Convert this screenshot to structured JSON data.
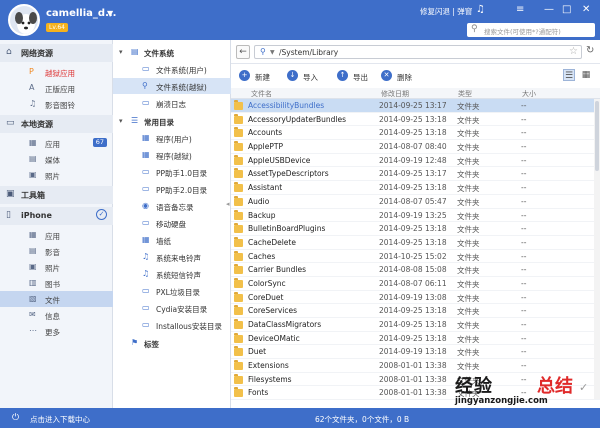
{
  "app": {
    "username": "camellia_d...",
    "vip_badge": "Lv.64",
    "repair_label": "修复闪退 | 弹窗",
    "search_placeholder": "搜索文件(可使用*?通配符)"
  },
  "sidebar": {
    "network": {
      "label": "网络资源",
      "items": [
        {
          "label": "越狱应用",
          "icon": "P",
          "red": true
        },
        {
          "label": "正版应用",
          "icon": "A"
        },
        {
          "label": "影音图铃",
          "icon": "♫"
        }
      ]
    },
    "local": {
      "label": "本地资源",
      "items": [
        {
          "label": "应用",
          "icon": "▦",
          "count": "67"
        },
        {
          "label": "媒体",
          "icon": "▤"
        },
        {
          "label": "照片",
          "icon": "▣"
        }
      ]
    },
    "toolbox": {
      "label": "工具箱"
    },
    "iphone": {
      "label": "iPhone",
      "items": [
        {
          "label": "应用",
          "icon": "▦"
        },
        {
          "label": "影音",
          "icon": "▤"
        },
        {
          "label": "照片",
          "icon": "▣"
        },
        {
          "label": "图书",
          "icon": "▥"
        },
        {
          "label": "文件",
          "icon": "▧"
        },
        {
          "label": "信息",
          "icon": "✉"
        },
        {
          "label": "更多",
          "icon": "⋯"
        }
      ]
    }
  },
  "tree": {
    "filesystem": {
      "label": "文件系统",
      "items": [
        {
          "label": "文件系统(用户)",
          "icon": "▭"
        },
        {
          "label": "文件系统(越狱)",
          "icon": "⚲"
        },
        {
          "label": "崩溃日志",
          "icon": "▭"
        }
      ]
    },
    "common": {
      "label": "常用目录",
      "items": [
        {
          "label": "程序(用户)",
          "icon": "▦"
        },
        {
          "label": "程序(越狱)",
          "icon": "▦"
        },
        {
          "label": "PP助手1.0目录",
          "icon": "▭"
        },
        {
          "label": "PP助手2.0目录",
          "icon": "▭"
        },
        {
          "label": "语音备忘录",
          "icon": "◉"
        },
        {
          "label": "移动硬盘",
          "icon": "▭"
        },
        {
          "label": "墙纸",
          "icon": "▦"
        },
        {
          "label": "系统来电铃声",
          "icon": "♫"
        },
        {
          "label": "系统短信铃声",
          "icon": "♫"
        },
        {
          "label": "PXL垃圾目录",
          "icon": "▭"
        },
        {
          "label": "Cydia安装目录",
          "icon": "▭"
        },
        {
          "label": "Installous安装目录",
          "icon": "▭"
        }
      ]
    },
    "tags": {
      "label": "标签"
    }
  },
  "path": "/System/Library",
  "toolbar": {
    "new": "新建",
    "import": "导入",
    "export": "导出",
    "delete": "删除"
  },
  "columns": {
    "name": "文件名",
    "date": "修改日期",
    "type": "类型",
    "size": "大小"
  },
  "files": [
    {
      "name": "AccessibilityBundles",
      "date": "2014-09-25 13:17",
      "type": "文件夹",
      "size": "--"
    },
    {
      "name": "AccessoryUpdaterBundles",
      "date": "2014-09-25 13:18",
      "type": "文件夹",
      "size": "--"
    },
    {
      "name": "Accounts",
      "date": "2014-09-25 13:18",
      "type": "文件夹",
      "size": "--"
    },
    {
      "name": "ApplePTP",
      "date": "2014-08-07 08:40",
      "type": "文件夹",
      "size": "--"
    },
    {
      "name": "AppleUSBDevice",
      "date": "2014-09-19 12:48",
      "type": "文件夹",
      "size": "--"
    },
    {
      "name": "AssetTypeDescriptors",
      "date": "2014-09-25 13:17",
      "type": "文件夹",
      "size": "--"
    },
    {
      "name": "Assistant",
      "date": "2014-09-25 13:18",
      "type": "文件夹",
      "size": "--"
    },
    {
      "name": "Audio",
      "date": "2014-08-07 05:47",
      "type": "文件夹",
      "size": "--"
    },
    {
      "name": "Backup",
      "date": "2014-09-19 13:25",
      "type": "文件夹",
      "size": "--"
    },
    {
      "name": "BulletinBoardPlugins",
      "date": "2014-09-25 13:18",
      "type": "文件夹",
      "size": "--"
    },
    {
      "name": "CacheDelete",
      "date": "2014-09-25 13:18",
      "type": "文件夹",
      "size": "--"
    },
    {
      "name": "Caches",
      "date": "2014-10-25 15:02",
      "type": "文件夹",
      "size": "--"
    },
    {
      "name": "Carrier Bundles",
      "date": "2014-08-08 15:08",
      "type": "文件夹",
      "size": "--"
    },
    {
      "name": "ColorSync",
      "date": "2014-08-07 06:11",
      "type": "文件夹",
      "size": "--"
    },
    {
      "name": "CoreDuet",
      "date": "2014-09-19 13:08",
      "type": "文件夹",
      "size": "--"
    },
    {
      "name": "CoreServices",
      "date": "2014-09-25 13:18",
      "type": "文件夹",
      "size": "--"
    },
    {
      "name": "DataClassMigrators",
      "date": "2014-09-25 13:18",
      "type": "文件夹",
      "size": "--"
    },
    {
      "name": "DeviceOMatic",
      "date": "2014-09-25 13:18",
      "type": "文件夹",
      "size": "--"
    },
    {
      "name": "Duet",
      "date": "2014-09-19 13:18",
      "type": "文件夹",
      "size": "--"
    },
    {
      "name": "Extensions",
      "date": "2008-01-01 13:38",
      "type": "文件夹",
      "size": "--"
    },
    {
      "name": "Filesystems",
      "date": "2008-01-01 13:38",
      "type": "文件夹",
      "size": "--"
    },
    {
      "name": "Fonts",
      "date": "2008-01-01 13:38",
      "type": "文件夹",
      "size": "--"
    }
  ],
  "status": {
    "download_center": "点击进入下载中心",
    "summary": "62个文件夹，0个文件，0 B"
  },
  "watermark": {
    "line1": "经验",
    "line2": "总结",
    "line3": "jingyanzongjie.com",
    "mark": "✓"
  }
}
